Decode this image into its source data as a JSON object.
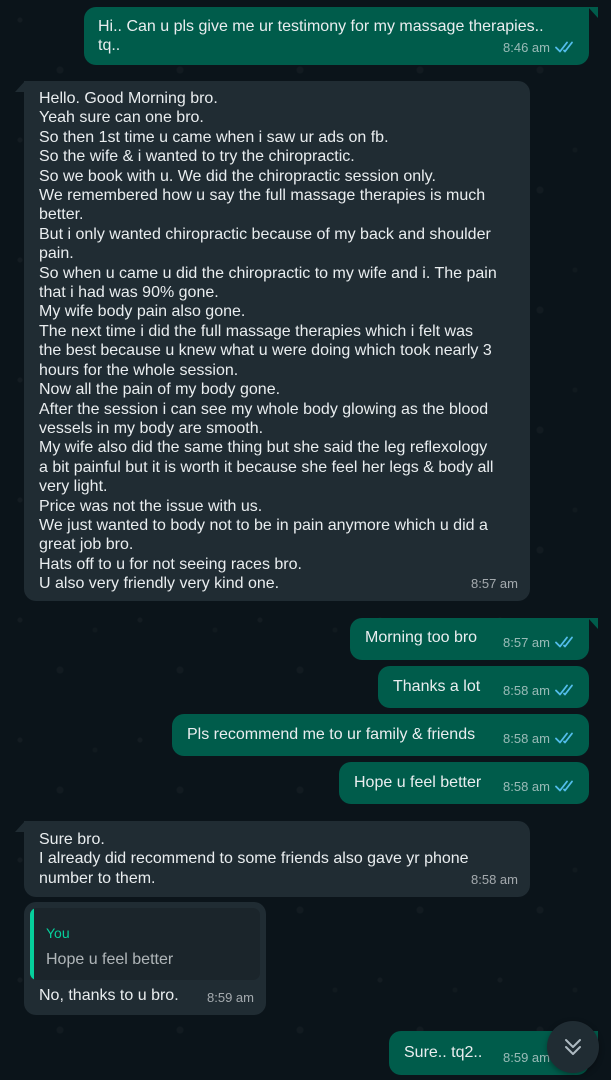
{
  "chat": {
    "messages": [
      {
        "id": "m1",
        "direction": "outgoing",
        "text": "Hi.. Can u pls give me ur testimony for my massage therapies..\ntq..",
        "time": "8:46 am",
        "status_icon": "double-check-read-icon"
      },
      {
        "id": "m2",
        "direction": "incoming",
        "text": "Hello. Good Morning bro.\nYeah sure can one bro.\nSo then 1st time u came when i saw ur ads on fb.\nSo the wife & i wanted to try the chiropractic.\nSo we book with u. We did the chiropractic session only.\nWe remembered how u say the full massage therapies is much\nbetter.\nBut i only wanted chiropractic because of my back and shoulder\npain.\nSo when u came u did the chiropractic to my wife and i. The pain\nthat i had was 90% gone.\nMy wife body pain also gone.\nThe next time i did the full massage therapies which i felt was\nthe best because u knew what u were doing which took nearly 3\nhours for the whole session.\nNow all the pain of my body gone.\nAfter the session i can see my whole body glowing as the blood\nvessels in my body are smooth.\nMy wife also did the same thing but she said the leg reflexology\na bit painful but it is worth it because she feel her legs & body all\nvery light.\nPrice was not the issue with us.\nWe just wanted to body not to be in pain anymore which u did a\ngreat job bro.\nHats off to u for not seeing races bro.\nU also very friendly very kind one.",
        "time": "8:57 am"
      },
      {
        "id": "m3",
        "direction": "outgoing",
        "text": "Morning too bro",
        "time": "8:57 am",
        "status_icon": "double-check-read-icon"
      },
      {
        "id": "m4",
        "direction": "outgoing",
        "text": "Thanks a lot",
        "time": "8:58 am",
        "status_icon": "double-check-read-icon"
      },
      {
        "id": "m5",
        "direction": "outgoing",
        "text": "Pls recommend me to ur family & friends",
        "time": "8:58 am",
        "status_icon": "double-check-read-icon"
      },
      {
        "id": "m6",
        "direction": "outgoing",
        "text": "Hope u feel better",
        "time": "8:58 am",
        "status_icon": "double-check-read-icon"
      },
      {
        "id": "m7",
        "direction": "incoming",
        "text": "Sure bro.\nI already did recommend to some friends also gave yr phone\nnumber to them.",
        "time": "8:58 am"
      },
      {
        "id": "m8",
        "direction": "incoming",
        "quote_author": "You",
        "quote_text": "Hope u feel better",
        "text": "No, thanks to u bro.",
        "time": "8:59 am"
      },
      {
        "id": "m9",
        "direction": "outgoing",
        "text": "Sure.. tq2..",
        "time": "8:59 am",
        "status_icon": "double-check-read-icon"
      }
    ],
    "scroll_button_icon": "double-chevron-down-icon",
    "colors": {
      "background": "#0b141a",
      "outgoing_bubble": "#005c4b",
      "incoming_bubble": "#202c33",
      "read_ticks": "#53bdeb",
      "quote_accent": "#06cf9c"
    }
  }
}
